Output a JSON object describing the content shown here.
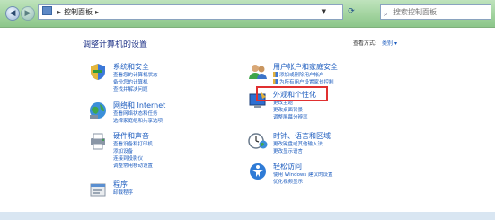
{
  "address": {
    "segments": [
      "控制面板"
    ],
    "placeholder_search": "搜索控制面板"
  },
  "page": {
    "title": "调整计算机的设置",
    "view_by_label": "查看方式:",
    "view_by_value": "类别"
  },
  "categories_left": [
    {
      "title": "系统和安全",
      "links": [
        "查看您的计算机状态",
        "备份您的计算机",
        "查找并解决问题"
      ]
    },
    {
      "title": "网络和 Internet",
      "links": [
        "查看网络状态和任务",
        "选择家庭组和共享选项"
      ]
    },
    {
      "title": "硬件和声音",
      "links": [
        "查看设备和打印机",
        "添加设备",
        "连接到投影仪",
        "调整常用移动设置"
      ]
    },
    {
      "title": "程序",
      "links": [
        "卸载程序"
      ]
    }
  ],
  "categories_right": [
    {
      "title": "用户帐户和家庭安全",
      "links": [
        "添加或删除用户帐户",
        "为所有用户设置家长控制"
      ]
    },
    {
      "title": "外观和个性化",
      "links": [
        "更改主题",
        "更改桌面背景",
        "调整屏幕分辨率"
      ]
    },
    {
      "title": "时钟、语言和区域",
      "links": [
        "更改键盘或其他输入法",
        "更改显示语言"
      ]
    },
    {
      "title": "轻松访问",
      "links": [
        "使用 Windows 建议的设置",
        "优化视频显示"
      ]
    }
  ],
  "colors": {
    "link": "#1e5dbf",
    "title": "#1e3287",
    "highlight": "#e03030"
  }
}
